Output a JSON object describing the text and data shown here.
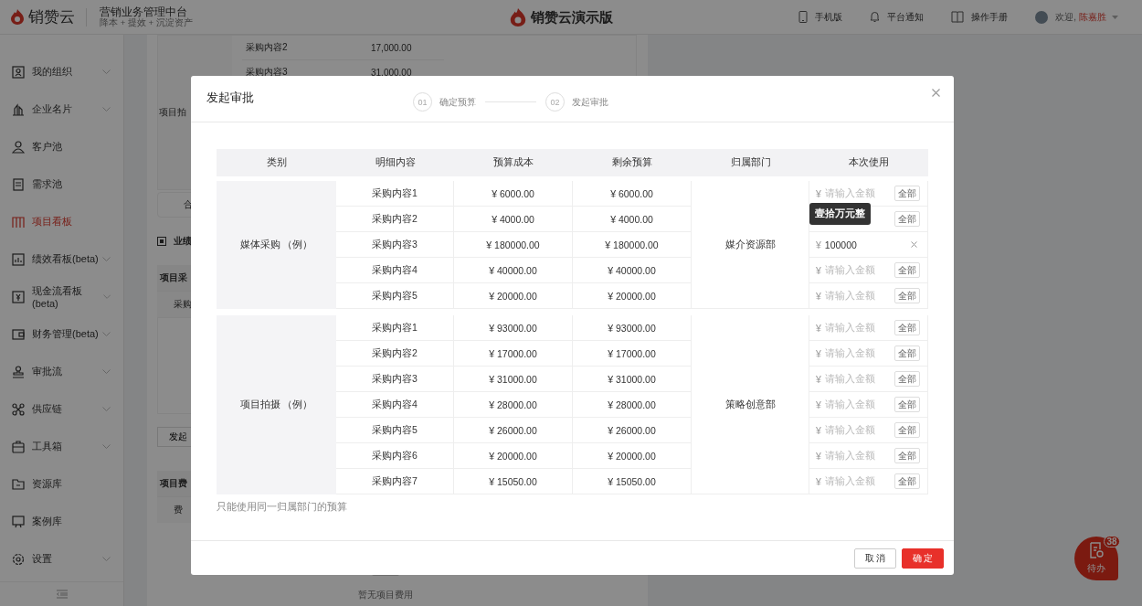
{
  "header": {
    "logo": "销赞云",
    "title": "营销业务管理中台",
    "subtitle": "降本 + 提效 + 沉淀资产",
    "brand": "销赞云演示版",
    "links": [
      {
        "label": "手机版"
      },
      {
        "label": "平台通知"
      },
      {
        "label": "操作手册"
      }
    ],
    "welcome": "欢迎,",
    "user": "陈嘉胜"
  },
  "sidebar": {
    "items": [
      {
        "label": "我的组织",
        "expandable": true,
        "selected": false
      },
      {
        "label": "企业名片",
        "expandable": true,
        "selected": false
      },
      {
        "label": "客户池",
        "expandable": false,
        "selected": false
      },
      {
        "label": "需求池",
        "expandable": false,
        "selected": false
      },
      {
        "label": "项目看板",
        "expandable": false,
        "selected": true
      },
      {
        "label": "绩效看板(beta)",
        "expandable": true,
        "selected": false
      },
      {
        "label": "现金流看板(beta)",
        "expandable": true,
        "selected": false
      },
      {
        "label": "财务管理(beta)",
        "expandable": true,
        "selected": false
      },
      {
        "label": "审批流",
        "expandable": true,
        "selected": false
      },
      {
        "label": "供应链",
        "expandable": true,
        "selected": false
      },
      {
        "label": "工具箱",
        "expandable": true,
        "selected": false
      },
      {
        "label": "资源库",
        "expandable": false,
        "selected": false
      },
      {
        "label": "案例库",
        "expandable": false,
        "selected": false
      },
      {
        "label": "设置",
        "expandable": true,
        "selected": false
      }
    ]
  },
  "background": {
    "rows": [
      {
        "item": "采购内容2",
        "amount": "17,000.00"
      },
      {
        "item": "采购内容3",
        "amount": "31,000.00"
      }
    ],
    "category": "项目拍",
    "total": "合",
    "section": "业绩",
    "table_head": "项目采",
    "table_row": "采购",
    "button": "发起",
    "fee_head": "项目费",
    "fee_row": "费",
    "empty": "暂无项目费用"
  },
  "modal": {
    "title": "发起审批",
    "steps": [
      {
        "number": "01",
        "label": "确定预算"
      },
      {
        "number": "02",
        "label": "发起审批"
      }
    ],
    "columns": [
      "类别",
      "明细内容",
      "预算成本",
      "剩余预算",
      "归属部门",
      "本次使用"
    ],
    "groups": [
      {
        "category": "媒体采购 （例）",
        "department": "媒介资源部",
        "rows": [
          {
            "item": "采购内容1",
            "cost": "¥ 6000.00",
            "remaining": "¥ 6000.00",
            "currency": "¥",
            "placeholder": "请输入金额",
            "all": "全部"
          },
          {
            "item": "采购内容2",
            "cost": "¥ 4000.00",
            "remaining": "¥ 4000.00",
            "all": "全部"
          },
          {
            "item": "采购内容3",
            "cost": "¥ 180000.00",
            "remaining": "¥ 180000.00",
            "currency": "¥",
            "value": "100000",
            "tooltip": "壹拾万元整"
          },
          {
            "item": "采购内容4",
            "cost": "¥ 40000.00",
            "remaining": "¥ 40000.00",
            "currency": "¥",
            "placeholder": "请输入金额",
            "all": "全部"
          },
          {
            "item": "采购内容5",
            "cost": "¥ 20000.00",
            "remaining": "¥ 20000.00",
            "currency": "¥",
            "placeholder": "请输入金额",
            "all": "全部"
          }
        ]
      },
      {
        "category": "项目拍摄 （例）",
        "department": "策略创意部",
        "rows": [
          {
            "item": "采购内容1",
            "cost": "¥ 93000.00",
            "remaining": "¥ 93000.00",
            "currency": "¥",
            "placeholder": "请输入金额",
            "all": "全部"
          },
          {
            "item": "采购内容2",
            "cost": "¥ 17000.00",
            "remaining": "¥ 17000.00",
            "currency": "¥",
            "placeholder": "请输入金额",
            "all": "全部"
          },
          {
            "item": "采购内容3",
            "cost": "¥ 31000.00",
            "remaining": "¥ 31000.00",
            "currency": "¥",
            "placeholder": "请输入金额",
            "all": "全部"
          },
          {
            "item": "采购内容4",
            "cost": "¥ 28000.00",
            "remaining": "¥ 28000.00",
            "currency": "¥",
            "placeholder": "请输入金额",
            "all": "全部"
          },
          {
            "item": "采购内容5",
            "cost": "¥ 26000.00",
            "remaining": "¥ 26000.00",
            "currency": "¥",
            "placeholder": "请输入金额",
            "all": "全部"
          },
          {
            "item": "采购内容6",
            "cost": "¥ 20000.00",
            "remaining": "¥ 20000.00",
            "currency": "¥",
            "placeholder": "请输入金额",
            "all": "全部"
          },
          {
            "item": "采购内容7",
            "cost": "¥ 15050.00",
            "remaining": "¥ 15050.00",
            "currency": "¥",
            "placeholder": "请输入金额",
            "all": "全部"
          }
        ]
      }
    ],
    "note": "只能使用同一归属部门的预算",
    "cancel": "取 消",
    "confirm": "确 定"
  },
  "todo": {
    "label": "待办",
    "count": "38"
  }
}
